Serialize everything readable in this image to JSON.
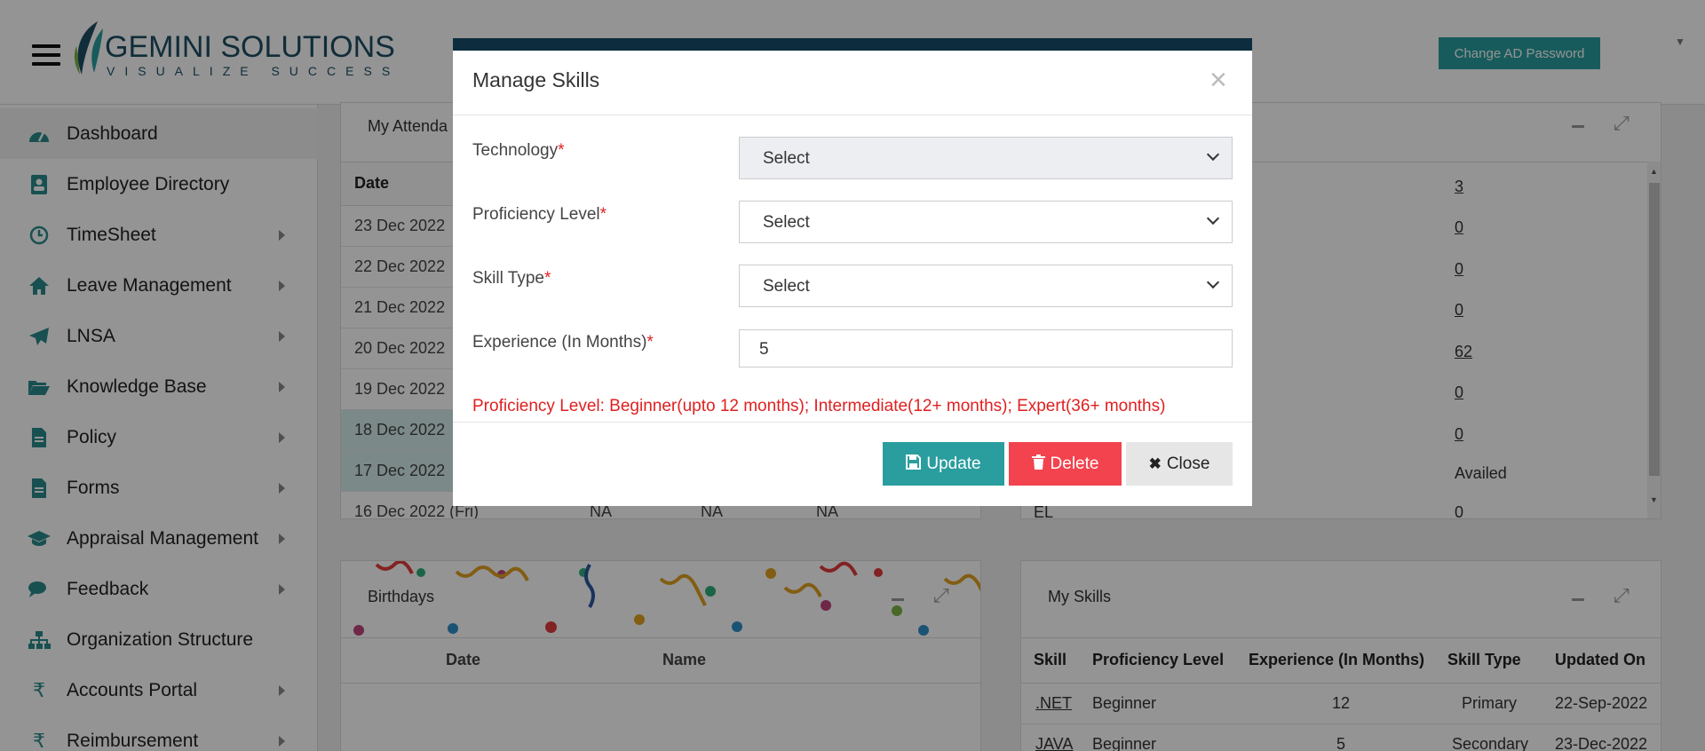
{
  "header": {
    "logo_main": "GEMINI SOLUTIONS",
    "logo_tagline": "VISUALIZE SUCCESS",
    "change_ad_password": "Change AD Password"
  },
  "sidebar": {
    "items": [
      {
        "label": "Dashboard",
        "icon": "dashboard-icon",
        "has_arrow": false
      },
      {
        "label": "Employee Directory",
        "icon": "address-book-icon",
        "has_arrow": false
      },
      {
        "label": "TimeSheet",
        "icon": "clock-icon",
        "has_arrow": true
      },
      {
        "label": "Leave Management",
        "icon": "home-icon",
        "has_arrow": true
      },
      {
        "label": "LNSA",
        "icon": "paper-plane-icon",
        "has_arrow": true
      },
      {
        "label": "Knowledge Base",
        "icon": "folder-open-icon",
        "has_arrow": true
      },
      {
        "label": "Policy",
        "icon": "file-icon",
        "has_arrow": true
      },
      {
        "label": "Forms",
        "icon": "file-text-icon",
        "has_arrow": true
      },
      {
        "label": "Appraisal Management",
        "icon": "graduation-cap-icon",
        "has_arrow": true
      },
      {
        "label": "Feedback",
        "icon": "comments-icon",
        "has_arrow": true
      },
      {
        "label": "Organization Structure",
        "icon": "sitemap-icon",
        "has_arrow": false
      },
      {
        "label": "Accounts Portal",
        "icon": "rupee-icon",
        "has_arrow": true
      },
      {
        "label": "Reimbursement",
        "icon": "rupee-icon",
        "has_arrow": true
      }
    ]
  },
  "attendance": {
    "title": "My Attenda",
    "date_header": "Date",
    "rows": [
      "23 Dec 2022",
      "22 Dec 2022",
      "21 Dec 2022",
      "20 Dec 2022",
      "19 Dec 2022",
      "18 Dec 2022",
      "17 Dec 2022",
      "16 Dec 2022 (Fri)"
    ],
    "na": "NA"
  },
  "leave_counts": {
    "values": [
      "3",
      "0",
      "0",
      "0",
      "62",
      "0",
      "0"
    ],
    "availed": "Availed",
    "partial_label": "EL",
    "partial_value": "0"
  },
  "birthdays": {
    "title": "Birthdays",
    "col_date": "Date",
    "col_name": "Name"
  },
  "skills": {
    "title": "My Skills",
    "headers": [
      "Skill",
      "Proficiency Level",
      "Experience (In Months)",
      "Skill Type",
      "Updated On"
    ],
    "rows": [
      {
        "skill": ".NET",
        "level": "Beginner",
        "exp": "12",
        "type": "Primary",
        "updated": "22-Sep-2022"
      },
      {
        "skill": "JAVA",
        "level": "Beginner",
        "exp": "5",
        "type": "Secondary",
        "updated": "23-Dec-2022"
      }
    ]
  },
  "modal": {
    "title": "Manage Skills",
    "close_glyph": "×",
    "required_mark": "*",
    "technology_label": "Technology",
    "technology_value": "Select",
    "proficiency_label": "Proficiency Level",
    "proficiency_value": "Select",
    "skill_type_label": "Skill Type",
    "skill_type_value": "Select",
    "experience_label": "Experience (In Months)",
    "experience_value": "5",
    "hint": "Proficiency Level: Beginner(upto 12 months); Intermediate(12+ months); Expert(36+ months)",
    "update_label": "Update",
    "delete_label": "Delete",
    "close_label": "Close"
  },
  "colors": {
    "accent": "#2a9d9f",
    "danger": "#f2434e",
    "modal_header": "#0d2d3e",
    "required": "#e02020"
  }
}
